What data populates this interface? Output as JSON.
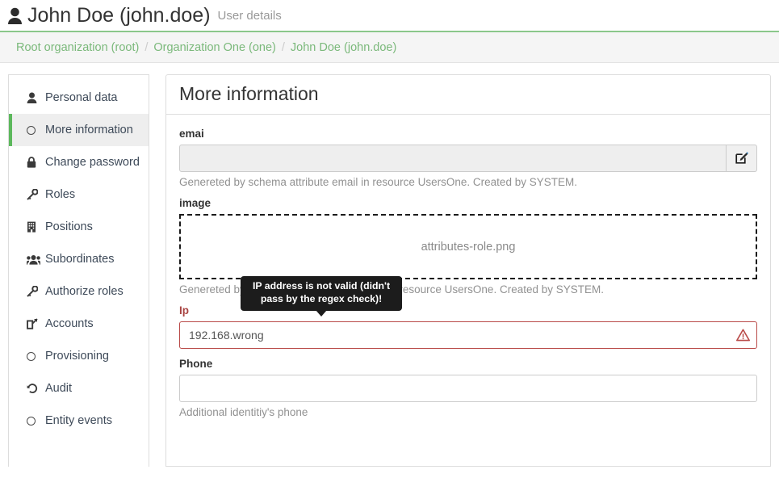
{
  "header": {
    "user_icon": "person-icon",
    "title": "John Doe (john.doe)",
    "subtitle": "User details"
  },
  "breadcrumb": {
    "separator": "/",
    "items": [
      {
        "label": "Root organization (root)"
      },
      {
        "label": "Organization One (one)"
      },
      {
        "label": "John Doe (john.doe)"
      }
    ]
  },
  "sidebar": {
    "items": [
      {
        "label": "Personal data",
        "icon": "person-icon",
        "active": false
      },
      {
        "label": "More information",
        "icon": "circle-icon",
        "active": true
      },
      {
        "label": "Change password",
        "icon": "lock-icon",
        "active": false
      },
      {
        "label": "Roles",
        "icon": "key-icon",
        "active": false
      },
      {
        "label": "Positions",
        "icon": "building-icon",
        "active": false
      },
      {
        "label": "Subordinates",
        "icon": "users-icon",
        "active": false
      },
      {
        "label": "Authorize roles",
        "icon": "key-icon",
        "active": false
      },
      {
        "label": "Accounts",
        "icon": "external-link-icon",
        "active": false
      },
      {
        "label": "Provisioning",
        "icon": "circle-icon",
        "active": false
      },
      {
        "label": "Audit",
        "icon": "history-icon",
        "active": false
      },
      {
        "label": "Entity events",
        "icon": "circle-icon",
        "active": false
      }
    ]
  },
  "panel": {
    "title": "More information"
  },
  "fields": {
    "email": {
      "label": "emai",
      "value": "",
      "placeholder": "",
      "help": "Genereted by schema attribute email in resource UsersOne. Created by SYSTEM.",
      "edit_icon": "edit-pencil-square-icon",
      "disabled": true
    },
    "image": {
      "label": "image",
      "filename": "attributes-role.png",
      "help": "Genereted by schema attribute description in resource UsersOne. Created by SYSTEM."
    },
    "ip": {
      "label": "Ip",
      "value": "192.168.wrong",
      "placeholder": "",
      "error": true,
      "error_icon": "warning-triangle-icon",
      "tooltip": "IP address is not valid (didn't pass by the regex check)!"
    },
    "phone": {
      "label": "Phone",
      "value": "",
      "placeholder": "",
      "help": "Additional identitiy's phone"
    }
  },
  "colors": {
    "accent_green": "#5cb85c",
    "link_green": "#7bb97b",
    "error_red": "#a94442",
    "error_border": "#b94a48",
    "tooltip_bg": "#1c1c1c"
  }
}
